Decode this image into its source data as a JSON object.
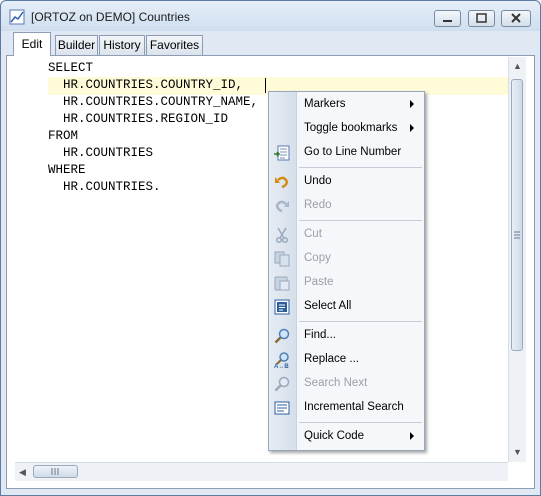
{
  "window": {
    "title": "[ORTOZ on DEMO] Countries"
  },
  "tabs": [
    {
      "label": "Edit",
      "active": true
    },
    {
      "label": "Builder",
      "active": false
    },
    {
      "label": "History",
      "active": false
    },
    {
      "label": "Favorites",
      "active": false
    }
  ],
  "editor": {
    "lines": [
      "SELECT",
      "  HR.COUNTRIES.COUNTRY_ID,",
      "  HR.COUNTRIES.COUNTRY_NAME,",
      "  HR.COUNTRIES.REGION_ID",
      "FROM",
      "  HR.COUNTRIES",
      "WHERE",
      "  HR.COUNTRIES."
    ]
  },
  "context_menu": {
    "items": [
      {
        "label": "Markers",
        "icon": "none",
        "submenu": true,
        "enabled": true
      },
      {
        "label": "Toggle bookmarks",
        "icon": "none",
        "submenu": true,
        "enabled": true
      },
      {
        "label": "Go to Line Number",
        "icon": "goto-line-icon",
        "submenu": false,
        "enabled": true
      },
      {
        "label": "Undo",
        "icon": "undo-icon",
        "submenu": false,
        "enabled": true
      },
      {
        "label": "Redo",
        "icon": "redo-icon",
        "submenu": false,
        "enabled": false
      },
      {
        "label": "Cut",
        "icon": "scissors-icon",
        "submenu": false,
        "enabled": false
      },
      {
        "label": "Copy",
        "icon": "copy-icon",
        "submenu": false,
        "enabled": false
      },
      {
        "label": "Paste",
        "icon": "paste-icon",
        "submenu": false,
        "enabled": false
      },
      {
        "label": "Select All",
        "icon": "select-all-icon",
        "submenu": false,
        "enabled": true
      },
      {
        "label": "Find...",
        "icon": "find-icon",
        "submenu": false,
        "enabled": true
      },
      {
        "label": "Replace ...",
        "icon": "replace-icon",
        "submenu": false,
        "enabled": true
      },
      {
        "label": "Search Next",
        "icon": "search-next-icon",
        "submenu": false,
        "enabled": false
      },
      {
        "label": "Incremental Search",
        "icon": "incremental-search-icon",
        "submenu": false,
        "enabled": true
      },
      {
        "label": "Quick Code",
        "icon": "none",
        "submenu": true,
        "enabled": true
      }
    ]
  },
  "colors": {
    "current_line": "#fffbd9",
    "menu_disabled_text": "#9aa0a8"
  }
}
